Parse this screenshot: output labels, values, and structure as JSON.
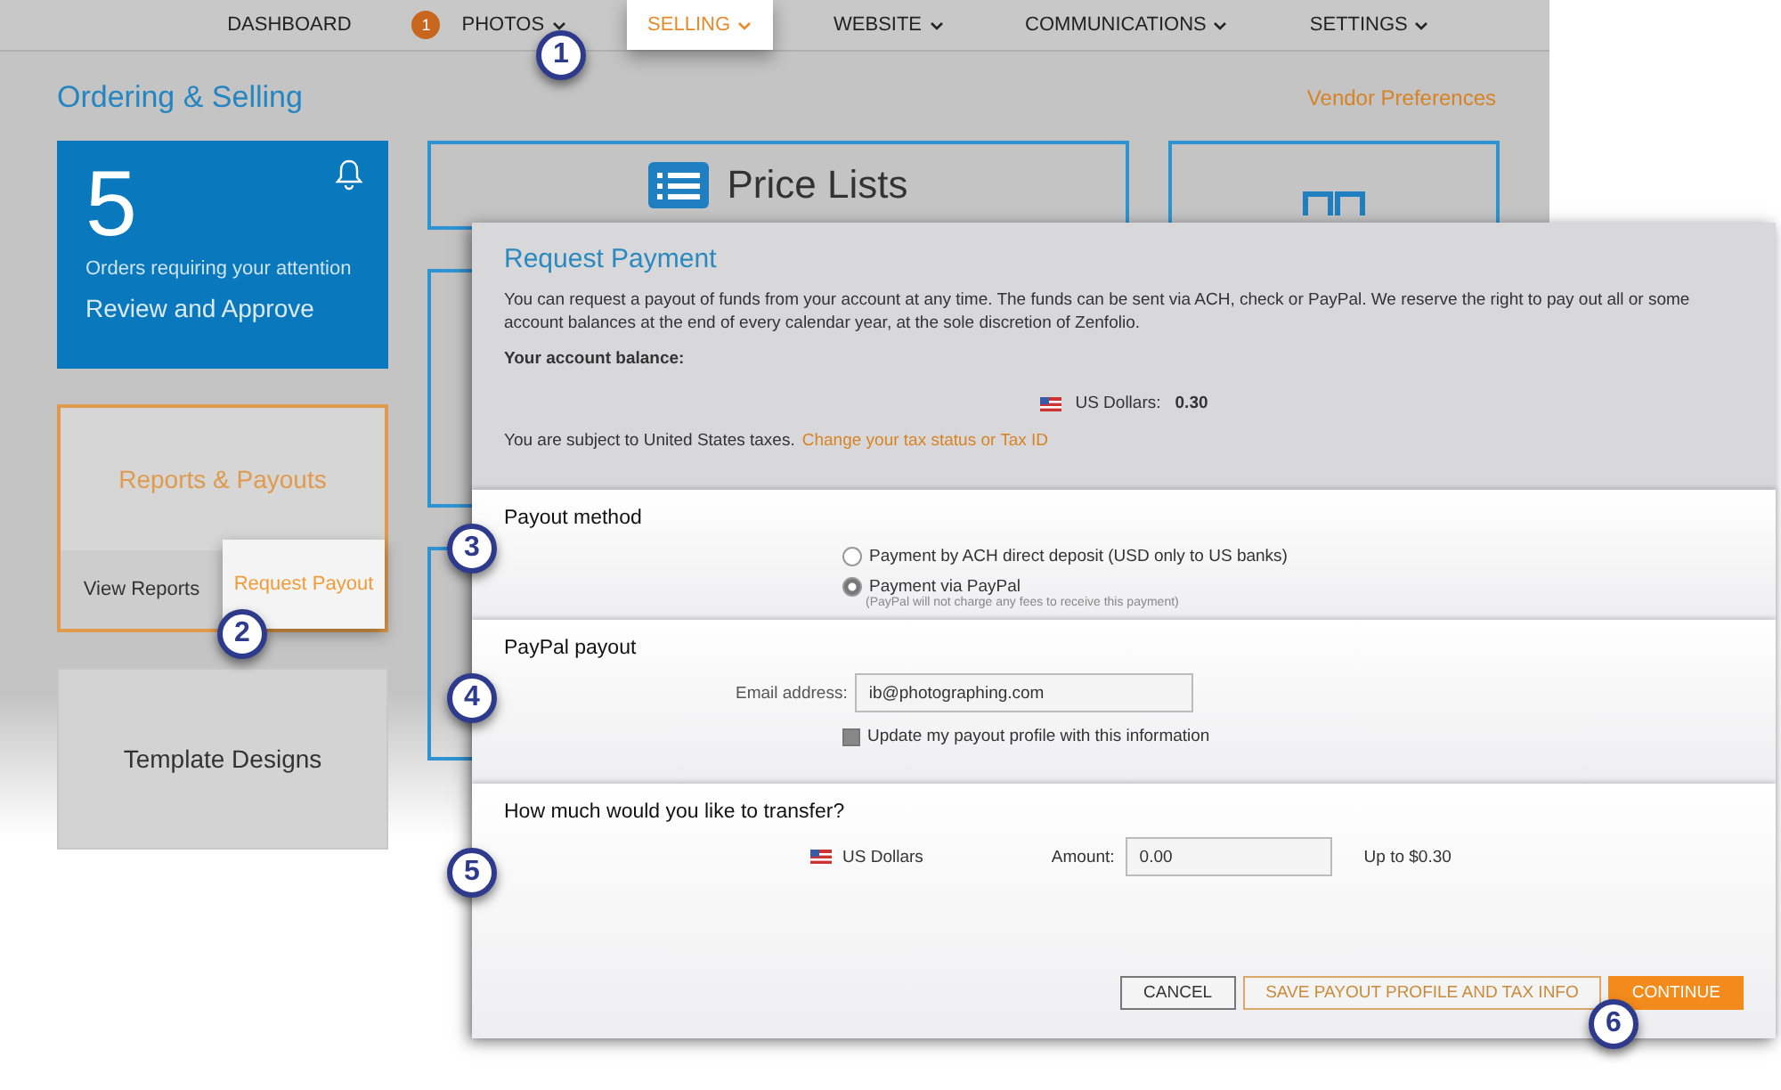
{
  "nav": {
    "items": [
      {
        "label": "DASHBOARD",
        "has_menu": false,
        "selected": false
      },
      {
        "label": "PHOTOS",
        "badge": "1",
        "has_menu": true,
        "selected": false
      },
      {
        "label": "SELLING",
        "has_menu": true,
        "selected": true
      },
      {
        "label": "WEBSITE",
        "has_menu": true,
        "selected": false
      },
      {
        "label": "COMMUNICATIONS",
        "has_menu": true,
        "selected": false
      },
      {
        "label": "SETTINGS",
        "has_menu": true,
        "selected": false
      }
    ]
  },
  "page": {
    "title": "Ordering & Selling",
    "link": "Vendor Preferences"
  },
  "attention_tile": {
    "count": "5",
    "caption": "Orders requiring your attention",
    "action": "Review and Approve"
  },
  "reports_tile": {
    "title": "Reports & Payouts",
    "actions": [
      {
        "label": "View Reports",
        "selected": false
      },
      {
        "label": "Request Payout",
        "selected": true
      }
    ]
  },
  "template_tile": {
    "title": "Template Designs"
  },
  "price_lists_tile": {
    "title": "Price Lists"
  },
  "dialog": {
    "title": "Request Payment",
    "intro": "You can request a payout of funds from your account at any time. The funds can be sent via ACH, check or PayPal. We reserve the right to pay out all or some account balances at the end of every calendar year, at the sole discretion of Zenfolio.",
    "balance_label": "Your account balance:",
    "balance": {
      "currency": "US Dollars:",
      "amount": "0.30"
    },
    "tax_note": "You are subject to United States taxes.",
    "tax_link": "Change your tax status or Tax ID",
    "payout_method": {
      "heading": "Payout method",
      "options": [
        {
          "label": "Payment by ACH direct deposit (USD only to US banks)",
          "selected": false
        },
        {
          "label": "Payment via PayPal",
          "note": "(PayPal will not charge any fees to receive this payment)",
          "selected": true
        }
      ]
    },
    "paypal": {
      "heading": "PayPal payout",
      "email_label": "Email address:",
      "email": "ib@photographing.com",
      "update_profile": {
        "label": "Update my payout profile with this information",
        "checked": true
      }
    },
    "transfer": {
      "heading": "How much would you like to transfer?",
      "currency": "US Dollars",
      "amount_label": "Amount:",
      "amount": "0.00",
      "limit": "Up to $0.30"
    },
    "buttons": [
      {
        "label": "CANCEL",
        "kind": "secondary"
      },
      {
        "label": "SAVE PAYOUT PROFILE AND TAX INFO",
        "kind": "outline"
      },
      {
        "label": "CONTINUE",
        "kind": "primary"
      }
    ]
  },
  "steps": [
    "1",
    "2",
    "3",
    "4",
    "5",
    "6"
  ]
}
